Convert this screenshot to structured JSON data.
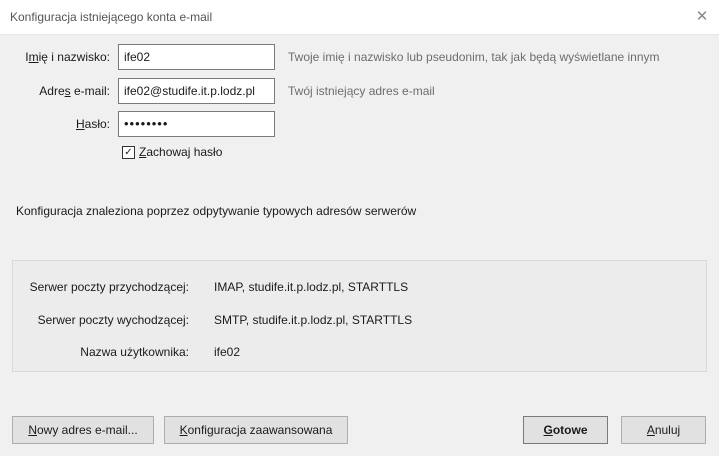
{
  "window": {
    "title": "Konfiguracja istniejącego konta e-mail",
    "close_glyph": "✕"
  },
  "form": {
    "name": {
      "label_pre": "I",
      "label_mn": "m",
      "label_post": "ię i nazwisko:",
      "value": "ife02",
      "hint": "Twoje imię i nazwisko lub pseudonim, tak jak będą wyświetlane innym"
    },
    "email": {
      "label_pre": "Adre",
      "label_mn": "s",
      "label_post": " e-mail:",
      "value": "ife02@studife.it.p.lodz.pl",
      "hint": "Twój istniejący adres e-mail"
    },
    "password": {
      "label_pre": "",
      "label_mn": "H",
      "label_post": "asło:",
      "value": "••••••••"
    },
    "remember": {
      "checked": true,
      "label_mn": "Z",
      "label_post": "achowaj hasło"
    }
  },
  "status_text": "Konfiguracja znaleziona poprzez odpytywanie typowych adresów serwerów",
  "server_info": [
    {
      "label": "Serwer poczty przychodzącej:",
      "value": "IMAP, studife.it.p.lodz.pl, STARTTLS"
    },
    {
      "label": "Serwer poczty wychodzącej:",
      "value": "SMTP, studife.it.p.lodz.pl, STARTTLS"
    },
    {
      "label": "Nazwa użytkownika:",
      "value": "ife02"
    }
  ],
  "buttons": {
    "new_address": {
      "pre": "",
      "mn": "N",
      "post": "owy adres e-mail..."
    },
    "advanced": {
      "pre": "",
      "mn": "K",
      "post": "onfiguracja zaawansowana"
    },
    "done": {
      "pre": "",
      "mn": "G",
      "post": "otowe"
    },
    "cancel": {
      "pre": "",
      "mn": "A",
      "post": "nuluj"
    }
  },
  "colors": {
    "background": "#f0f0f0",
    "field_border": "#7a7a7a",
    "hint_text": "#6d6d6d"
  },
  "icons": {
    "close": "close-icon",
    "checkbox": "checkmark-icon"
  }
}
